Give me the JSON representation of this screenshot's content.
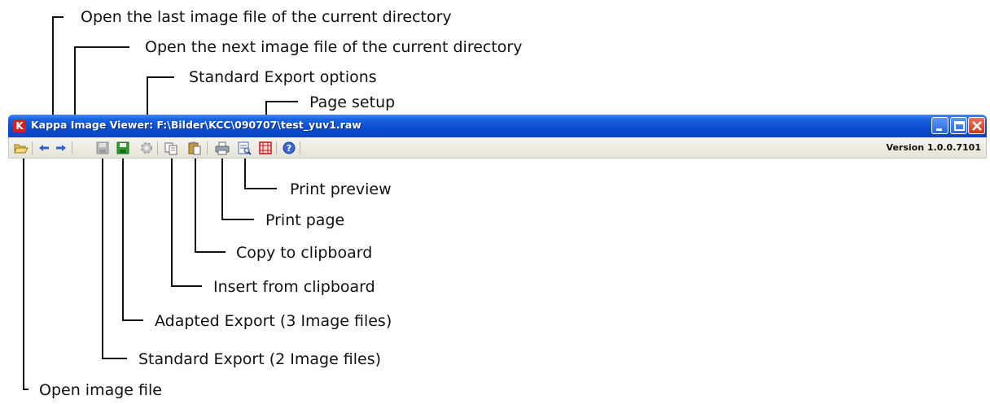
{
  "window": {
    "title": "Kappa Image Viewer: F:\\Bilder\\KCC\\090707\\test_yuv1.raw",
    "app_icon_letter": "K",
    "version": "Version 1.0.0.7101"
  },
  "callouts": {
    "last_image": "Open the last image file of the current directory",
    "next_image": "Open the next image file of the current directory",
    "export_options": "Standard Export options",
    "page_setup": "Page setup",
    "print_preview": "Print preview",
    "print_page": "Print page",
    "copy_clipboard": "Copy to clipboard",
    "insert_clipboard": "Insert from clipboard",
    "adapted_export": "Adapted Export (3 Image files)",
    "standard_export": "Standard Export (2 Image files)",
    "open_image": "Open image file"
  },
  "colors": {
    "title_bar": "#0a4ecf",
    "close_button": "#c63a1c"
  }
}
